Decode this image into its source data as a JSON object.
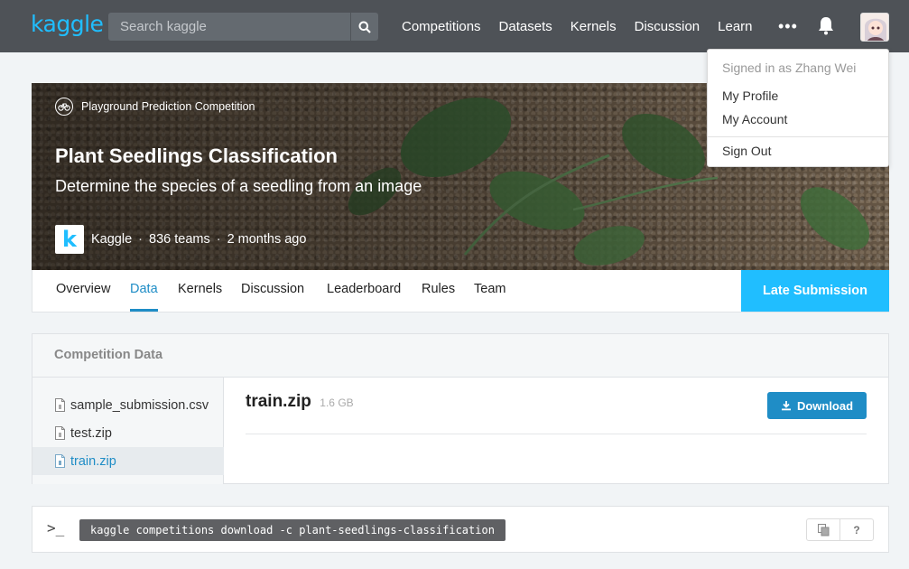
{
  "nav": {
    "logo": "kaggle",
    "search_placeholder": "Search kaggle",
    "links": [
      "Competitions",
      "Datasets",
      "Kernels",
      "Discussion",
      "Learn"
    ],
    "more": "•••"
  },
  "user_menu": {
    "signed_in": "Signed in as Zhang Wei",
    "items": [
      "My Profile",
      "My Account",
      "Sign Out"
    ]
  },
  "hero": {
    "type": "Playground Prediction Competition",
    "title": "Plant Seedlings Classification",
    "subtitle": "Determine the species of a seedling from an image",
    "host_logo": "k",
    "host": "Kaggle",
    "teams": "836 teams",
    "time": "2 months ago"
  },
  "tabs": [
    "Overview",
    "Data",
    "Kernels",
    "Discussion",
    "Leaderboard",
    "Rules",
    "Team"
  ],
  "active_tab": "Data",
  "late_submission": "Late Submission",
  "competition_data": {
    "header": "Competition Data",
    "files": [
      "sample_submission.csv",
      "test.zip",
      "train.zip"
    ],
    "selected_file": "train.zip",
    "file_name": "train.zip",
    "file_size": "1.6 GB",
    "download_label": "Download"
  },
  "cli": {
    "prompt": ">_",
    "command": "kaggle competitions download -c plant-seedlings-classification",
    "help": "?"
  },
  "colors": {
    "accent": "#20beff",
    "link": "#1f8dc6",
    "nav_bg": "#4e5257"
  }
}
